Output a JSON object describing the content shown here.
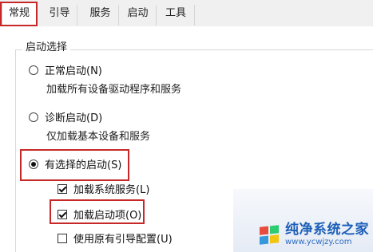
{
  "tabs": [
    {
      "label": "常规"
    },
    {
      "label": "引导"
    },
    {
      "label": "服务"
    },
    {
      "label": "启动"
    },
    {
      "label": "工具"
    }
  ],
  "startup_group": {
    "title": "启动选择",
    "normal": {
      "label": "正常启动(N)",
      "desc": "加载所有设备驱动程序和服务",
      "selected": false
    },
    "diagnostic": {
      "label": "诊断启动(D)",
      "desc": "仅加载基本设备和服务",
      "selected": false
    },
    "selective": {
      "label": "有选择的启动(S)",
      "selected": true
    },
    "options": {
      "load_system_services": {
        "label": "加载系统服务(L)",
        "checked": true
      },
      "load_startup_items": {
        "label": "加载启动项(O)",
        "checked": true
      },
      "use_original_boot": {
        "label": "使用原有引导配置(U)",
        "checked": false
      }
    }
  },
  "watermark": {
    "title": "纯净系统之家",
    "url": "www.ycwjzy.com",
    "logo_colors": [
      "#e74c3c",
      "#2ecc71",
      "#3498db",
      "#f1c40f"
    ]
  },
  "colors": {
    "highlight": "#c62828",
    "watermark_text": "#1d5fb8"
  }
}
